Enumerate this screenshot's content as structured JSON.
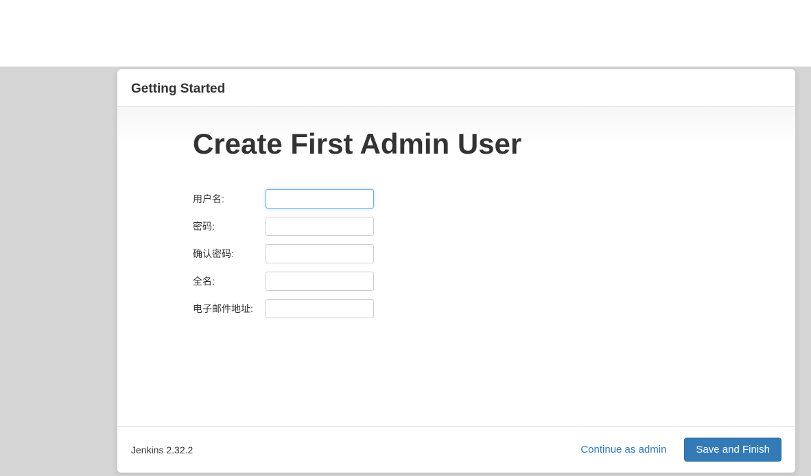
{
  "modal": {
    "header": "Getting Started",
    "title": "Create First Admin User"
  },
  "form": {
    "username": {
      "label": "用户名:",
      "value": ""
    },
    "password": {
      "label": "密码:",
      "value": ""
    },
    "confirm_password": {
      "label": "确认密码:",
      "value": ""
    },
    "fullname": {
      "label": "全名:",
      "value": ""
    },
    "email": {
      "label": "电子邮件地址:",
      "value": ""
    }
  },
  "footer": {
    "version": "Jenkins 2.32.2",
    "continue_label": "Continue as admin",
    "save_label": "Save and Finish"
  }
}
